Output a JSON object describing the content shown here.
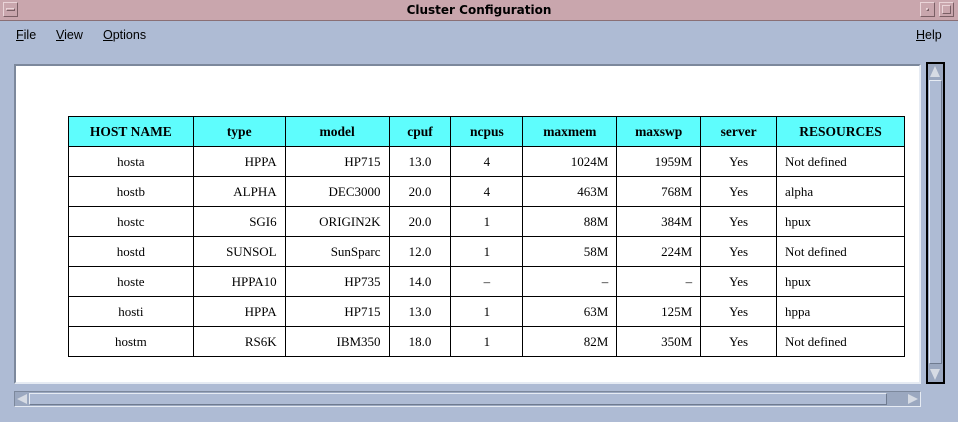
{
  "window": {
    "title": "Cluster Configuration"
  },
  "menu": {
    "file": {
      "mnemonic": "F",
      "rest": "ile"
    },
    "view": {
      "mnemonic": "V",
      "rest": "iew"
    },
    "options": {
      "mnemonic": "O",
      "rest": "ptions"
    },
    "help": {
      "mnemonic": "H",
      "rest": "elp"
    }
  },
  "table": {
    "headers": [
      "HOST NAME",
      "type",
      "model",
      "cpuf",
      "ncpus",
      "maxmem",
      "maxswp",
      "server",
      "RESOURCES"
    ],
    "rows": [
      [
        "hosta",
        "HPPA",
        "HP715",
        "13.0",
        "4",
        "1024M",
        "1959M",
        "Yes",
        "Not defined"
      ],
      [
        "hostb",
        "ALPHA",
        "DEC3000",
        "20.0",
        "4",
        "463M",
        "768M",
        "Yes",
        "alpha"
      ],
      [
        "hostc",
        "SGI6",
        "ORIGIN2K",
        "20.0",
        "1",
        "88M",
        "384M",
        "Yes",
        "hpux"
      ],
      [
        "hostd",
        "SUNSOL",
        "SunSparc",
        "12.0",
        "1",
        "58M",
        "224M",
        "Yes",
        "Not defined"
      ],
      [
        "hoste",
        "HPPA10",
        "HP735",
        "14.0",
        "–",
        "–",
        "–",
        "Yes",
        "hpux"
      ],
      [
        "hosti",
        "HPPA",
        "HP715",
        "13.0",
        "1",
        "63M",
        "125M",
        "Yes",
        "hppa"
      ],
      [
        "hostm",
        "RS6K",
        "IBM350",
        "18.0",
        "1",
        "82M",
        "350M",
        "Yes",
        "Not defined"
      ]
    ]
  },
  "colors": {
    "header_bg": "#5efdfd",
    "titlebar_bg": "#c9a6ad",
    "window_bg": "#aebbd4"
  }
}
